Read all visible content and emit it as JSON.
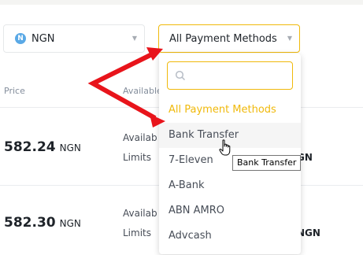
{
  "filters": {
    "currency": {
      "code": "NGN",
      "coin_letter": "N"
    },
    "payment": {
      "label": "All Payment Methods"
    }
  },
  "table": {
    "headers": {
      "price": "Price",
      "available": "Available"
    },
    "rows": [
      {
        "price": "582.24",
        "currency": "NGN",
        "label_1": "Availab",
        "label_2": "Limits",
        "amount_cut": "GN"
      },
      {
        "price": "582.30",
        "currency": "NGN",
        "label_1": "Availab",
        "label_2": "Limits",
        "amount_cut": "NGN"
      }
    ]
  },
  "dropdown": {
    "search_value": "",
    "options": [
      {
        "label": "All Payment Methods",
        "state": "selected"
      },
      {
        "label": "Bank Transfer",
        "state": "hover"
      },
      {
        "label": "7-Eleven",
        "state": ""
      },
      {
        "label": "A-Bank",
        "state": ""
      },
      {
        "label": "ABN AMRO",
        "state": ""
      },
      {
        "label": "Advcash",
        "state": ""
      }
    ]
  },
  "tooltip": "Bank Transfer",
  "colors": {
    "accent": "#f0b90b",
    "annotation_arrow": "#e8141b",
    "coin": "#5aa9e6"
  }
}
